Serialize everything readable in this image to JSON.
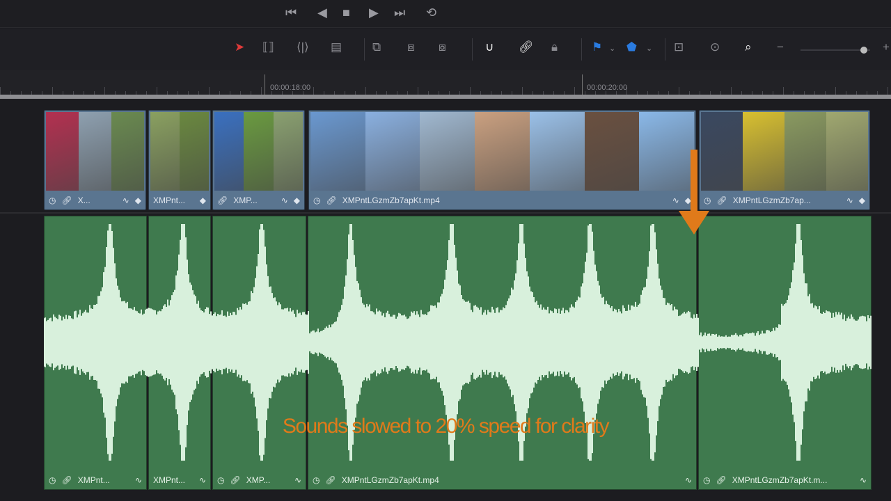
{
  "transport": {
    "icons": [
      "skip-back-icon",
      "step-back-icon",
      "stop-icon",
      "play-icon",
      "skip-forward-icon",
      "loop-icon"
    ],
    "glyphs": [
      "⏮",
      "◀",
      "■",
      "▶",
      "⏭",
      "⟲"
    ]
  },
  "toolbar": {
    "tools": [
      {
        "name": "selection-tool",
        "glyph": "➤",
        "color": "#e03a3a"
      },
      {
        "name": "trim-tool",
        "glyph": "⟦⟧"
      },
      {
        "name": "dynamic-trim-tool",
        "glyph": "⟨|⟩"
      },
      {
        "name": "blade-tool",
        "glyph": "▤"
      },
      {
        "name": "insert-clip",
        "glyph": "⧉"
      },
      {
        "name": "overwrite-clip",
        "glyph": "⧈"
      },
      {
        "name": "replace-clip",
        "glyph": "⧇"
      },
      {
        "name": "snapping-toggle",
        "glyph": "∪",
        "color": "#f0f0f0"
      },
      {
        "name": "linked-selection",
        "glyph": "🔗︎",
        "color": "#f0f0f0"
      },
      {
        "name": "position-lock",
        "glyph": "🔒︎"
      },
      {
        "name": "flag",
        "glyph": "⚑",
        "color": "#2a7be0"
      },
      {
        "name": "marker",
        "glyph": "⬟",
        "color": "#2a7be0"
      },
      {
        "name": "zoom-full",
        "glyph": "⊡"
      },
      {
        "name": "zoom-detail",
        "glyph": "⊙"
      },
      {
        "name": "zoom-custom",
        "glyph": "⌕",
        "color": "#f0f0f0"
      },
      {
        "name": "zoom-out",
        "glyph": "−"
      }
    ]
  },
  "zoom_slider": {
    "value": 0.9
  },
  "ruler": {
    "timecodes": [
      "00:00:18:00",
      "00:00:20:00"
    ]
  },
  "video_clips": [
    {
      "name": "X...",
      "icons": [
        "speed",
        "link"
      ],
      "trail": [
        "curve",
        "keyframe"
      ]
    },
    {
      "name": "XMPnt...",
      "icons": [],
      "trail": [
        "keyframe"
      ]
    },
    {
      "name": "XMP...",
      "icons": [
        "link"
      ],
      "trail": [
        "curve",
        "keyframe"
      ]
    },
    {
      "name": "XMPntLGzmZb7apKt.mp4",
      "icons": [
        "speed",
        "link"
      ],
      "trail": [
        "curve",
        "keyframe"
      ]
    },
    {
      "name": "XMPntLGzmZb7ap...",
      "icons": [
        "speed",
        "link"
      ],
      "trail": [
        "curve",
        "keyframe"
      ]
    }
  ],
  "audio_clips": [
    {
      "name": "XMPnt...",
      "icons": [
        "speed",
        "link"
      ]
    },
    {
      "name": "XMPnt...",
      "icons": []
    },
    {
      "name": "XMP...",
      "icons": [
        "speed",
        "link"
      ]
    },
    {
      "name": "XMPntLGzmZb7apKt.mp4",
      "icons": [
        "speed",
        "link"
      ]
    },
    {
      "name": "XMPntLGzmZb7apKt.m...",
      "icons": [
        "speed",
        "link"
      ]
    }
  ],
  "caption": "Sounds slowed to 20% speed for clarity",
  "colors": {
    "accent": "#e07a1a",
    "audio": "#3f7a4e",
    "video": "#5a7590"
  }
}
